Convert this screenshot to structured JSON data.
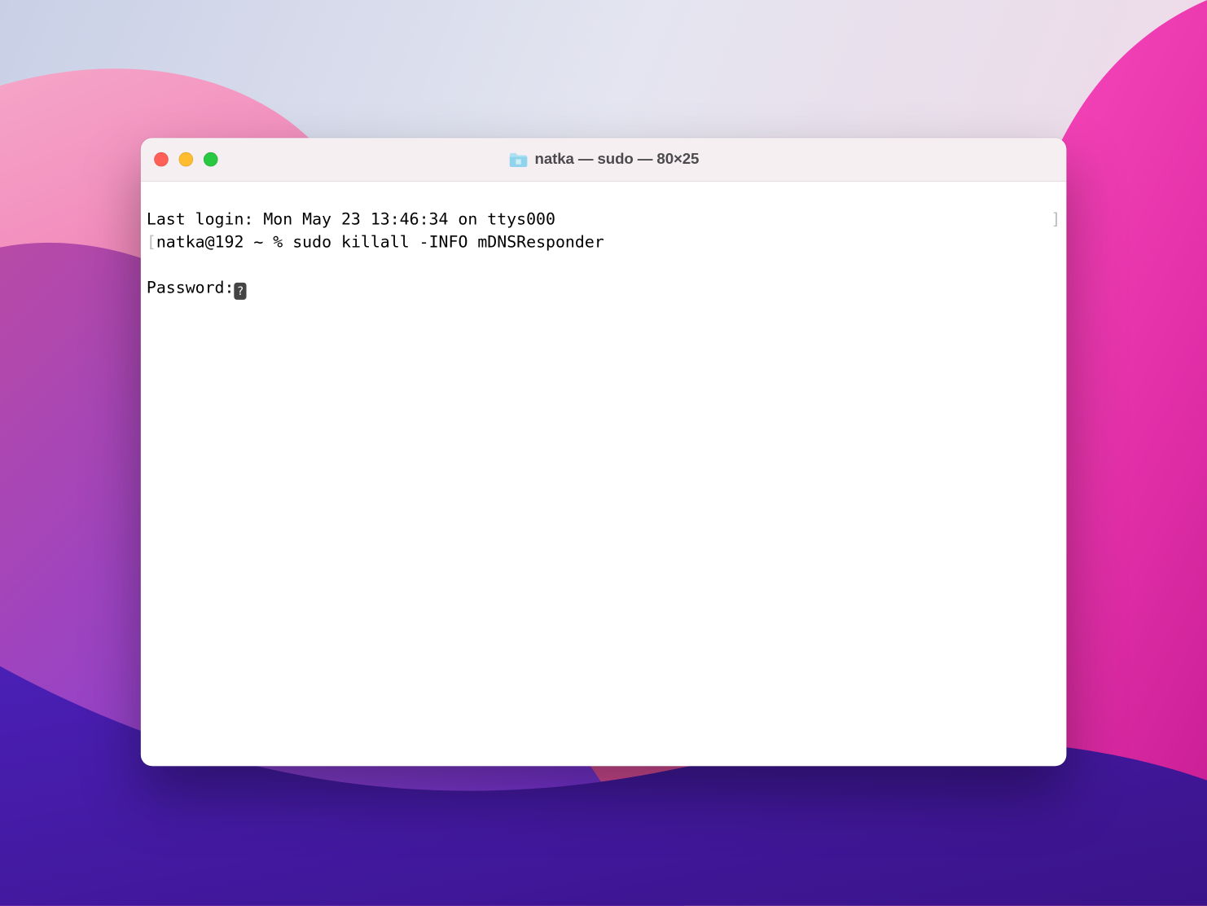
{
  "window": {
    "title": "natka — sudo — 80×25"
  },
  "terminal": {
    "last_login_line": "Last login: Mon May 23 13:46:34 on ttys000",
    "open_bracket": "[",
    "prompt": "natka@192 ~ % ",
    "command": "sudo killall -INFO mDNSResponder",
    "close_bracket": "]",
    "password_prompt": "Password:"
  }
}
